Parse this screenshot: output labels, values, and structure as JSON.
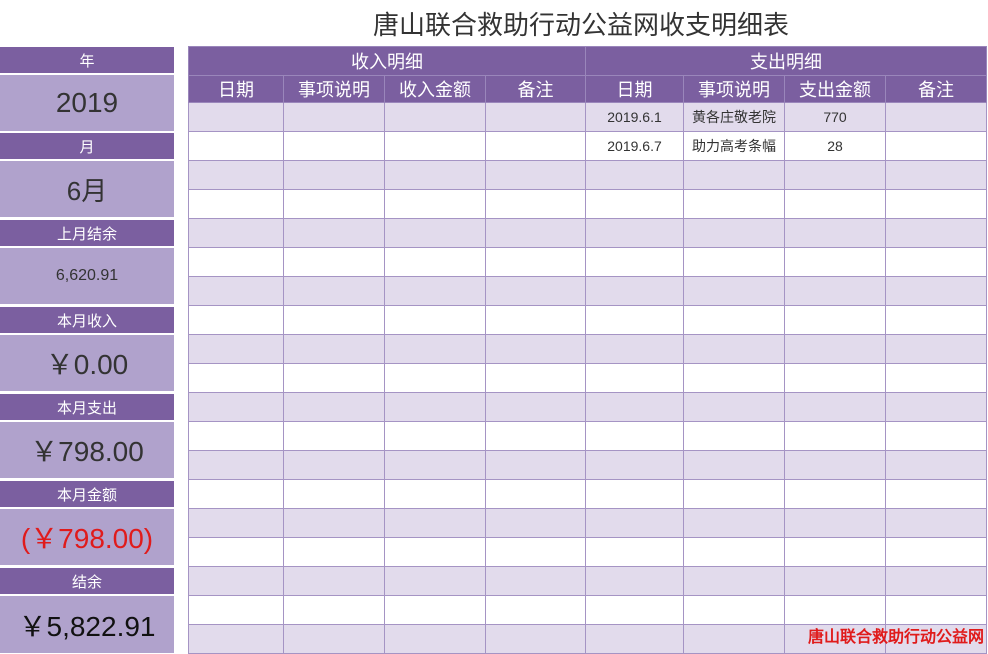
{
  "title": "唐山联合救助行动公益网收支明细表",
  "summary": {
    "year_label": "年",
    "year_value": "2019",
    "month_label": "月",
    "month_value": "6月",
    "prev_balance_label": "上月结余",
    "prev_balance_value": "6,620.91",
    "income_label": "本月收入",
    "income_value": "￥0.00",
    "expense_label": "本月支出",
    "expense_value": "￥798.00",
    "net_label": "本月金额",
    "net_value": "(￥798.00)",
    "balance_label": "结余",
    "balance_value": "￥5,822.91"
  },
  "income": {
    "section_title": "收入明细",
    "columns": [
      "日期",
      "事项说明",
      "收入金额",
      "备注"
    ]
  },
  "expense": {
    "section_title": "支出明细",
    "columns": [
      "日期",
      "事项说明",
      "支出金额",
      "备注"
    ]
  },
  "rows": [
    {
      "in_date": "",
      "in_desc": "",
      "in_amount": "",
      "in_note": "",
      "ex_date": "2019.6.1",
      "ex_desc": "黄各庄敬老院",
      "ex_amount": "770",
      "ex_note": ""
    },
    {
      "in_date": "",
      "in_desc": "",
      "in_amount": "",
      "in_note": "",
      "ex_date": "2019.6.7",
      "ex_desc": "助力高考条幅",
      "ex_amount": "28",
      "ex_note": ""
    },
    {
      "in_date": "",
      "in_desc": "",
      "in_amount": "",
      "in_note": "",
      "ex_date": "",
      "ex_desc": "",
      "ex_amount": "",
      "ex_note": ""
    },
    {
      "in_date": "",
      "in_desc": "",
      "in_amount": "",
      "in_note": "",
      "ex_date": "",
      "ex_desc": "",
      "ex_amount": "",
      "ex_note": ""
    },
    {
      "in_date": "",
      "in_desc": "",
      "in_amount": "",
      "in_note": "",
      "ex_date": "",
      "ex_desc": "",
      "ex_amount": "",
      "ex_note": ""
    },
    {
      "in_date": "",
      "in_desc": "",
      "in_amount": "",
      "in_note": "",
      "ex_date": "",
      "ex_desc": "",
      "ex_amount": "",
      "ex_note": ""
    },
    {
      "in_date": "",
      "in_desc": "",
      "in_amount": "",
      "in_note": "",
      "ex_date": "",
      "ex_desc": "",
      "ex_amount": "",
      "ex_note": ""
    },
    {
      "in_date": "",
      "in_desc": "",
      "in_amount": "",
      "in_note": "",
      "ex_date": "",
      "ex_desc": "",
      "ex_amount": "",
      "ex_note": ""
    },
    {
      "in_date": "",
      "in_desc": "",
      "in_amount": "",
      "in_note": "",
      "ex_date": "",
      "ex_desc": "",
      "ex_amount": "",
      "ex_note": ""
    },
    {
      "in_date": "",
      "in_desc": "",
      "in_amount": "",
      "in_note": "",
      "ex_date": "",
      "ex_desc": "",
      "ex_amount": "",
      "ex_note": ""
    },
    {
      "in_date": "",
      "in_desc": "",
      "in_amount": "",
      "in_note": "",
      "ex_date": "",
      "ex_desc": "",
      "ex_amount": "",
      "ex_note": ""
    },
    {
      "in_date": "",
      "in_desc": "",
      "in_amount": "",
      "in_note": "",
      "ex_date": "",
      "ex_desc": "",
      "ex_amount": "",
      "ex_note": ""
    },
    {
      "in_date": "",
      "in_desc": "",
      "in_amount": "",
      "in_note": "",
      "ex_date": "",
      "ex_desc": "",
      "ex_amount": "",
      "ex_note": ""
    },
    {
      "in_date": "",
      "in_desc": "",
      "in_amount": "",
      "in_note": "",
      "ex_date": "",
      "ex_desc": "",
      "ex_amount": "",
      "ex_note": ""
    },
    {
      "in_date": "",
      "in_desc": "",
      "in_amount": "",
      "in_note": "",
      "ex_date": "",
      "ex_desc": "",
      "ex_amount": "",
      "ex_note": ""
    },
    {
      "in_date": "",
      "in_desc": "",
      "in_amount": "",
      "in_note": "",
      "ex_date": "",
      "ex_desc": "",
      "ex_amount": "",
      "ex_note": ""
    },
    {
      "in_date": "",
      "in_desc": "",
      "in_amount": "",
      "in_note": "",
      "ex_date": "",
      "ex_desc": "",
      "ex_amount": "",
      "ex_note": ""
    },
    {
      "in_date": "",
      "in_desc": "",
      "in_amount": "",
      "in_note": "",
      "ex_date": "",
      "ex_desc": "",
      "ex_amount": "",
      "ex_note": ""
    },
    {
      "in_date": "",
      "in_desc": "",
      "in_amount": "",
      "in_note": "",
      "ex_date": "",
      "ex_desc": "",
      "ex_amount": "",
      "ex_note": ""
    }
  ],
  "footer": "唐山联合救助行动公益网",
  "colors": {
    "header_purple": "#7b5fa0",
    "panel_lilac": "#b0a2cc",
    "row_alt": "#e2dbec",
    "negative_red": "#e01b1b"
  }
}
